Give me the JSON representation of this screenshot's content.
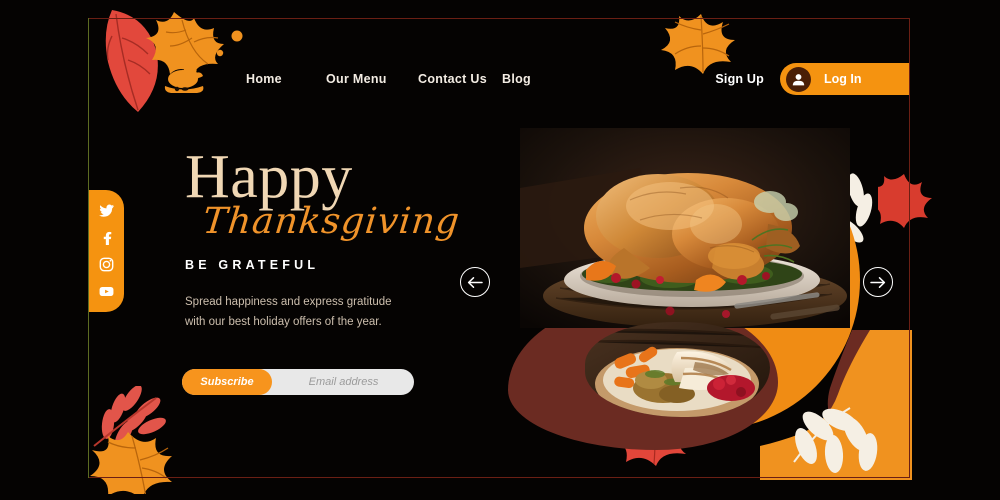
{
  "theme": {
    "background": "#050302",
    "accent_orange": "#f59310",
    "accent_orange_bright": "#f7941d",
    "cream": "#f0d7b4",
    "script_orange": "#f0932a",
    "maroon": "#6b2b22",
    "frame_border": "#6b1f14",
    "body_text": "#cdbfae"
  },
  "navbar": {
    "logo_icon": "roast-turkey-icon",
    "links": [
      {
        "label": "Home"
      },
      {
        "label": "Our Menu"
      },
      {
        "label": "Contact Us"
      },
      {
        "label": "Blog"
      }
    ],
    "signup_label": "Sign Up",
    "login_label": "Log In",
    "login_icon": "user-avatar-icon"
  },
  "social": {
    "items": [
      {
        "icon": "twitter-icon",
        "name": "Twitter"
      },
      {
        "icon": "facebook-icon",
        "name": "Facebook"
      },
      {
        "icon": "instagram-icon",
        "name": "Instagram"
      },
      {
        "icon": "youtube-icon",
        "name": "YouTube"
      }
    ]
  },
  "hero": {
    "title_line1": "Happy",
    "title_line2": "Thanksgiving",
    "tagline": "BE GRATEFUL",
    "paragraph": "Spread happiness and express gratitude with our best holiday offers of the year."
  },
  "subscribe": {
    "button_label": "Subscribe",
    "input_value": "",
    "input_placeholder": "Email address"
  },
  "carousel": {
    "prev_icon": "arrow-left-icon",
    "next_icon": "arrow-right-icon"
  },
  "imagery": {
    "main_photo_alt": "Roasted whole turkey on a platter with herbs, cranberries and orange slices",
    "secondary_photo_alt": "Plated sliced turkey with carrots, stuffing and cranberry sauce"
  },
  "decorations": {
    "top_left_leaves": "maple-leaf-cluster",
    "top_center_leaf": "orange-maple-leaf",
    "bottom_left_leaves": "red-branch-and-maple-leaf",
    "bottom_right_blob": "orange-blob-with-white-leaves",
    "white_fern_leaves": "white-fern-leaf",
    "red_maple_accent": "red-maple-leaf"
  }
}
